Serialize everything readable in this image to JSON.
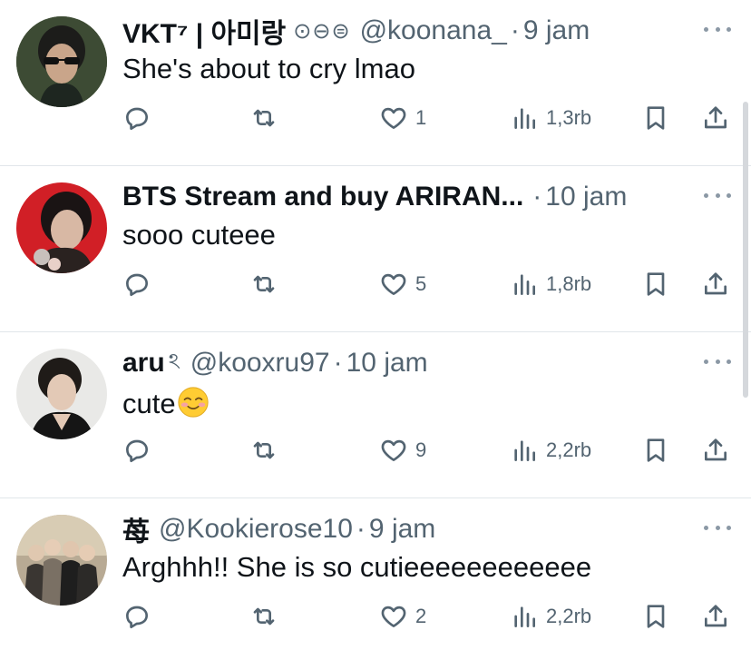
{
  "colors": {
    "text": "#0f1419",
    "muted": "#536471",
    "divider": "#e1e6ea"
  },
  "replies": [
    {
      "name": "VKT⁷ | 아미랑",
      "badges": "⊙⊖⊜",
      "handle": "@koonana_",
      "time": "9 jam",
      "text": "She's about to cry lmao",
      "likes": "1",
      "views": "1,3rb"
    },
    {
      "name": "BTS Stream and buy ARIRAN...",
      "badges": "",
      "handle": "",
      "time": "10 jam",
      "text": "sooo cuteee",
      "likes": "5",
      "views": "1,8rb"
    },
    {
      "name": "aru",
      "badges": "ঽ",
      "handle": "@kooxru97",
      "time": "10 jam",
      "text": "cute",
      "text_emoji": "smiling-face-emoji",
      "likes": "9",
      "views": "2,2rb"
    },
    {
      "name": "苺",
      "badges": "",
      "handle": "@Kookierose10",
      "time": "9 jam",
      "text": "Arghhh!! She is so cutieeeeeeeeeeee",
      "likes": "2",
      "views": "2,2rb"
    }
  ],
  "separator": "·",
  "icons": [
    "reply-icon",
    "retweet-icon",
    "like-icon",
    "views-icon",
    "bookmark-icon",
    "share-icon",
    "more-icon"
  ]
}
